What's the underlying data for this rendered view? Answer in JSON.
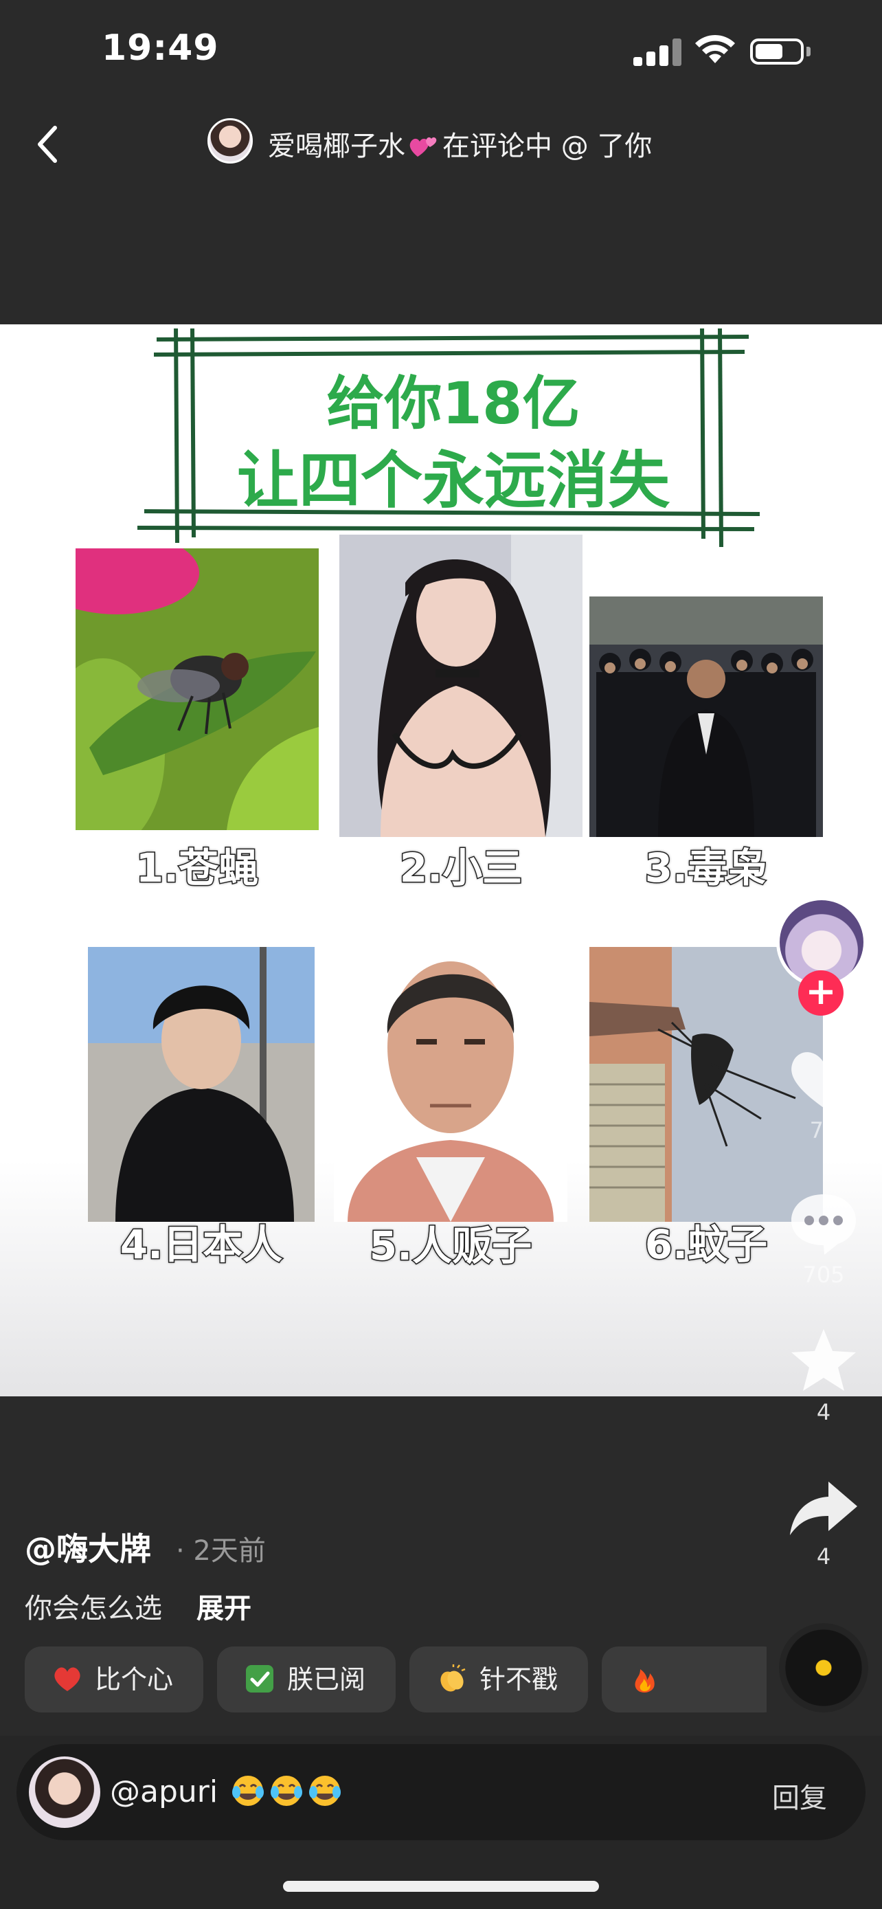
{
  "status_bar": {
    "time": "19:49"
  },
  "header": {
    "title_name": "爱喝椰子水",
    "title_suffix": "在评论中 @ 了你"
  },
  "post_image": {
    "title_line1": "给你18亿",
    "title_line2": "让四个永远消失",
    "options": [
      {
        "label": "1.苍蝇"
      },
      {
        "label": "2.小三"
      },
      {
        "label": "3.毒枭"
      },
      {
        "label": "4.日本人"
      },
      {
        "label": "5.人贩子"
      },
      {
        "label": "6.蚊子"
      }
    ]
  },
  "actions": {
    "follow_symbol": "+",
    "like_count": "70",
    "comment_count": "705",
    "favorite_count": "4",
    "share_count": "4"
  },
  "caption": {
    "author": "@嗨大牌",
    "time": "· 2天前",
    "text": "你会怎么选",
    "expand_label": "展开"
  },
  "quick_replies": [
    {
      "icon": "heart-emoji",
      "label": "比个心"
    },
    {
      "icon": "check-emoji",
      "label": "朕已阅"
    },
    {
      "icon": "clap-emoji",
      "label": "针不戳"
    },
    {
      "icon": "fire-emoji",
      "label": ""
    }
  ],
  "reply_bar": {
    "mention_text": "@apuri",
    "reply_label": "回复"
  },
  "colors": {
    "title_green": "#2daa4b",
    "frame_green": "#1f5a33",
    "follow_red": "#fe2c55",
    "background": "#2a2a2a"
  }
}
